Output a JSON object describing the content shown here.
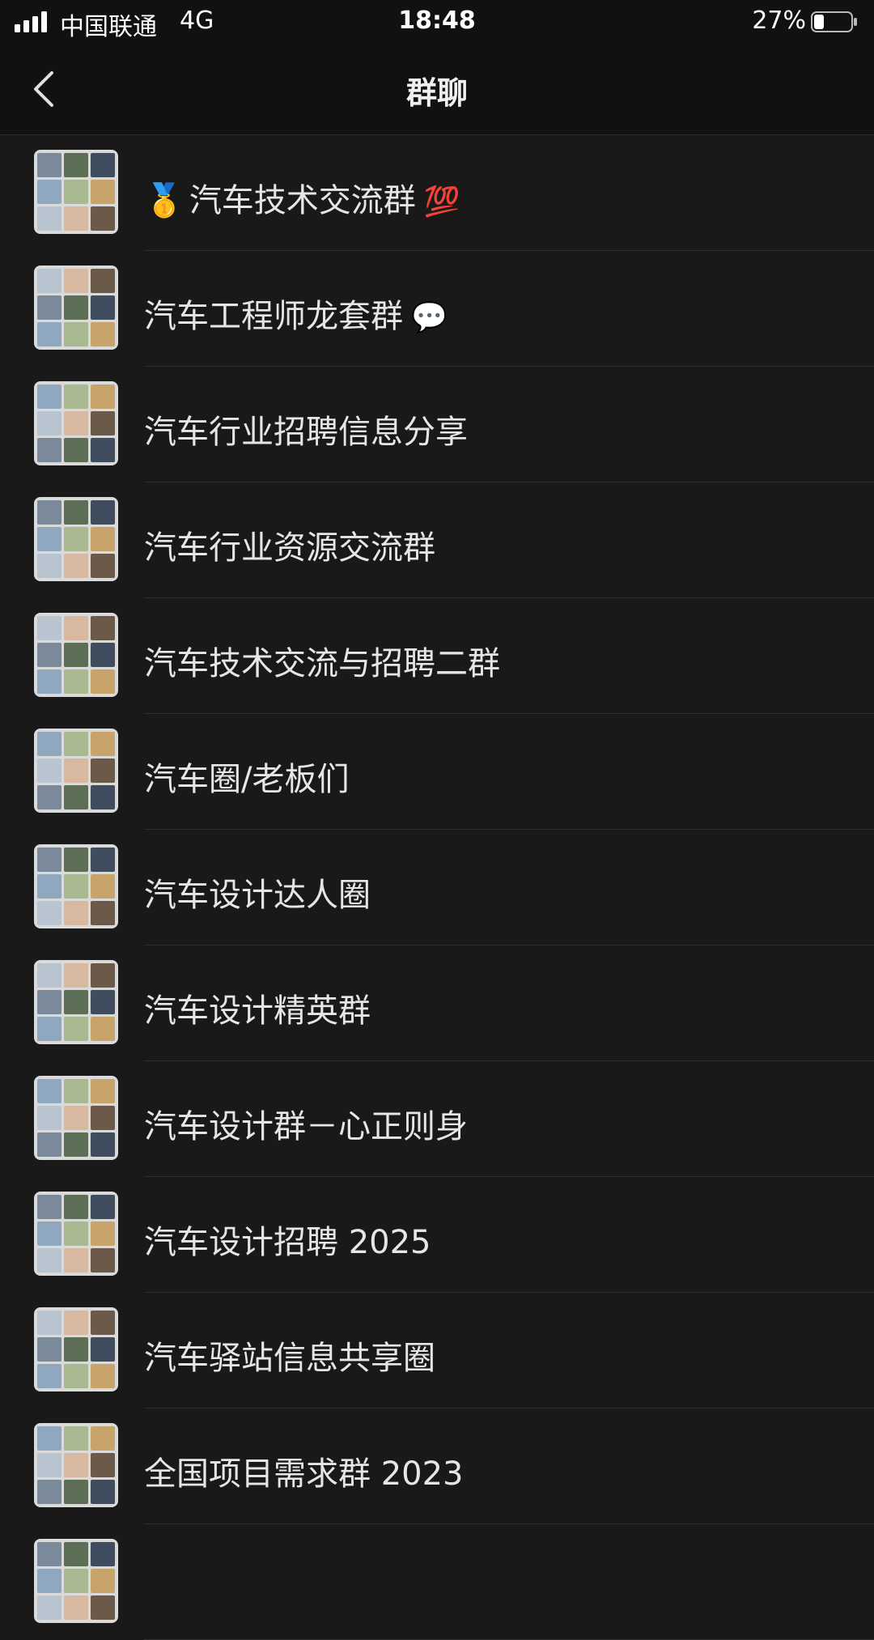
{
  "status_bar": {
    "carrier": "中国联通",
    "network": "4G",
    "time": "18:48",
    "battery_percent": "27%",
    "battery_level": 0.27
  },
  "nav": {
    "title": "群聊"
  },
  "groups": [
    {
      "name": "汽车技术交流群",
      "pre_icon": "🥇",
      "post_icon": "💯"
    },
    {
      "name": "汽车工程师龙套群",
      "pre_icon": "",
      "post_icon": "💬"
    },
    {
      "name": "汽车行业招聘信息分享",
      "pre_icon": "",
      "post_icon": ""
    },
    {
      "name": "汽车行业资源交流群",
      "pre_icon": "",
      "post_icon": ""
    },
    {
      "name": "汽车技术交流与招聘二群",
      "pre_icon": "",
      "post_icon": ""
    },
    {
      "name": "汽车圈/老板们",
      "pre_icon": "",
      "post_icon": ""
    },
    {
      "name": "汽车设计达人圈",
      "pre_icon": "",
      "post_icon": ""
    },
    {
      "name": "汽车设计精英群",
      "pre_icon": "",
      "post_icon": ""
    },
    {
      "name": "汽车设计群－心正则身",
      "pre_icon": "",
      "post_icon": ""
    },
    {
      "name": "汽车设计招聘 2025",
      "pre_icon": "",
      "post_icon": ""
    },
    {
      "name": "汽车驿站信息共享圈",
      "pre_icon": "",
      "post_icon": ""
    },
    {
      "name": "全国项目需求群 2023",
      "pre_icon": "",
      "post_icon": ""
    },
    {
      "name": "",
      "pre_icon": "",
      "post_icon": ""
    }
  ],
  "colors": {
    "background": "#191919",
    "header_bg": "#111111",
    "text": "#e6e6e6",
    "avatar_tiles": [
      "#7a8a9a",
      "#c9a46a",
      "#5d6e57",
      "#b8c4cf",
      "#3f4d5e",
      "#d9b8a0",
      "#8fa7bf",
      "#6b5a4a",
      "#a8b88f"
    ]
  }
}
